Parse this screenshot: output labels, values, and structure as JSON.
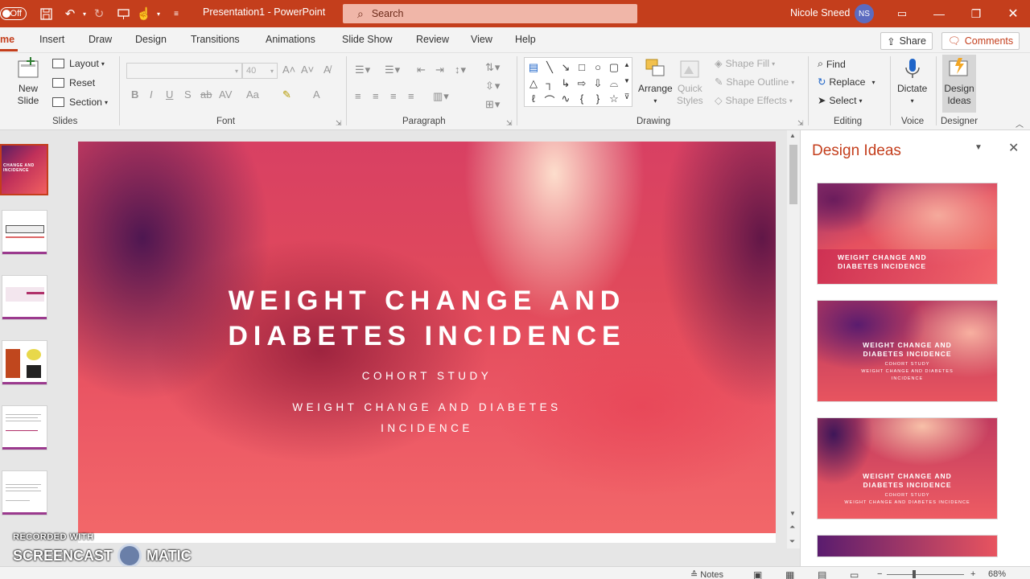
{
  "titlebar": {
    "autosave_label": "Off",
    "doc_title": "Presentation1  -  PowerPoint",
    "search_placeholder": "Search",
    "user_name": "Nicole Sneed",
    "user_initials": "NS",
    "icons": [
      "save-icon",
      "undo-icon",
      "redo-icon",
      "present-from-beginning-icon",
      "touch-mode-icon",
      "customize-quick-access-icon"
    ]
  },
  "tabs": [
    "me",
    "Insert",
    "Draw",
    "Design",
    "Transitions",
    "Animations",
    "Slide Show",
    "Review",
    "View",
    "Help"
  ],
  "share_label": "Share",
  "comments_label": "Comments",
  "ribbon": {
    "slides": {
      "new_slide": "New",
      "new_slide2": "Slide",
      "layout": "Layout",
      "reset": "Reset",
      "section": "Section",
      "group": "Slides"
    },
    "font": {
      "size": "40",
      "group": "Font"
    },
    "paragraph": {
      "group": "Paragraph"
    },
    "drawing": {
      "arrange": "Arrange",
      "quick_styles": "Quick",
      "quick_styles2": "Styles",
      "shape_fill": "Shape Fill",
      "shape_outline": "Shape Outline",
      "shape_effects": "Shape Effects",
      "group": "Drawing"
    },
    "editing": {
      "find": "Find",
      "replace": "Replace",
      "select": "Select",
      "group": "Editing"
    },
    "voice": {
      "dictate": "Dictate",
      "group": "Voice"
    },
    "designer": {
      "design_ideas": "Design",
      "design_ideas2": "Ideas",
      "group": "Designer"
    }
  },
  "thumbnails": {
    "t1_line1": "CHANGE AND",
    "t1_line2": "INCIDENCE"
  },
  "slide": {
    "title_line1": "WEIGHT CHANGE AND",
    "title_line2": "DIABETES INCIDENCE",
    "subtitle1": "COHORT STUDY",
    "subtitle2": "WEIGHT CHANGE AND DIABETES INCIDENCE"
  },
  "design_pane": {
    "title": "Design Ideas",
    "idea_title_1": "WEIGHT CHANGE AND",
    "idea_title_2": "DIABETES INCIDENCE",
    "idea_sub_1": "COHORT STUDY",
    "idea_sub_2": "WEIGHT CHANGE AND DIABETES",
    "idea_sub_3": "INCIDENCE",
    "idea_sub_full": "WEIGHT CHANGE AND DIABETES INCIDENCE"
  },
  "watermark": {
    "line1": "RECORDED WITH",
    "line2a": "SCREENCAST",
    "line2b": "MATIC"
  },
  "status": {
    "notes": "Notes",
    "zoom": "68%",
    "zoom_level": 0.68
  }
}
